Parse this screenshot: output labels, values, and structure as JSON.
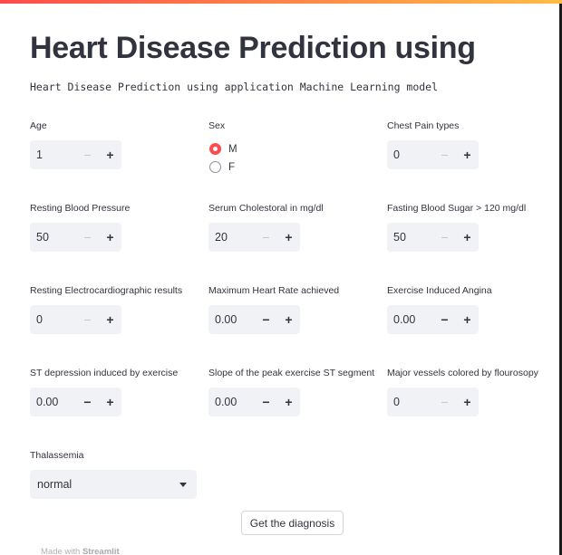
{
  "header": {
    "title": "Heart Disease Prediction using",
    "subtitle": "Heart Disease Prediction using application Machine Learning model"
  },
  "fields": {
    "age": {
      "label": "Age",
      "value": "1"
    },
    "sex": {
      "label": "Sex",
      "options": [
        "M",
        "F"
      ],
      "selected": "M"
    },
    "chest_pain": {
      "label": "Chest Pain types",
      "value": "0"
    },
    "resting_bp": {
      "label": "Resting Blood Pressure",
      "value": "50"
    },
    "cholesterol": {
      "label": "Serum Cholestoral in mg/dl",
      "value": "20"
    },
    "fasting_sugar": {
      "label": "Fasting Blood Sugar > 120 mg/dl",
      "value": "50"
    },
    "resting_ecg": {
      "label": "Resting Electrocardiographic results",
      "value": "0"
    },
    "max_heart_rate": {
      "label": "Maximum Heart Rate achieved",
      "value": "0.00"
    },
    "exercise_angina": {
      "label": "Exercise Induced Angina",
      "value": "0.00"
    },
    "st_depression": {
      "label": "ST depression induced by exercise",
      "value": "0.00"
    },
    "st_slope": {
      "label": "Slope of the peak exercise ST segment",
      "value": "0.00"
    },
    "major_vessels": {
      "label": "Major vessels colored by flourosopy",
      "value": "0"
    },
    "thalassemia": {
      "label": "Thalassemia",
      "value": "normal"
    }
  },
  "stepper": {
    "minus": "−",
    "plus": "+"
  },
  "actions": {
    "diagnose_label": "Get the diagnosis"
  },
  "footer": {
    "prefix": "Made with",
    "brand": "Streamlit"
  },
  "colors": {
    "accent": "#ff4b4b",
    "input_bg": "#f0f2f6",
    "text": "#31333f"
  }
}
